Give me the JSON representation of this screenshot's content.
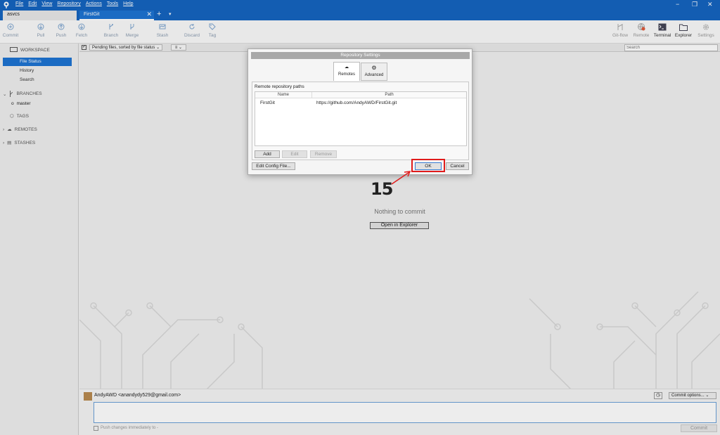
{
  "menu": [
    "File",
    "Edit",
    "View",
    "Repository",
    "Actions",
    "Tools",
    "Help"
  ],
  "tabs": {
    "tab1": "asvcs",
    "tab2": "FirstGit",
    "add": "+",
    "dropdown": "▾",
    "close": "✕"
  },
  "window": {
    "minimize": "−",
    "restore": "❐",
    "close": "✕"
  },
  "toolbar": {
    "commit": "Commit",
    "pull": "Pull",
    "push": "Push",
    "fetch": "Fetch",
    "branch": "Branch",
    "merge": "Merge",
    "stash": "Stash",
    "discard": "Discard",
    "tag": "Tag",
    "gitflow": "Git-flow",
    "remote": "Remote",
    "terminal": "Terminal",
    "explorer": "Explorer",
    "settings": "Settings",
    "remote_badge": "1"
  },
  "sidebar": {
    "workspace": "WORKSPACE",
    "file_status": "File Status",
    "history": "History",
    "search": "Search",
    "branches": "BRANCHES",
    "master": "master",
    "tags": "TAGS",
    "remotes": "REMOTES",
    "stashes": "STASHES"
  },
  "filter": {
    "label": "Pending files, sorted by file status",
    "search_placeholder": "Search"
  },
  "main": {
    "nothing": "Nothing to commit",
    "open_explorer": "Open in Explorer"
  },
  "bottom": {
    "author": "AndyAWD <anandydy529@gmail.com>",
    "commit_options": "Commit options...",
    "push_label": "Push changes immediately to -",
    "commit_btn": "Commit"
  },
  "dialog": {
    "title": "Repository Settings",
    "tab_remotes": "Remotes",
    "tab_advanced": "Advanced",
    "section": "Remote repository paths",
    "col_name": "Name",
    "col_path": "Path",
    "row_name": "FirstGit",
    "row_path": "https://github.com/AndyAWD/FirstGit.git",
    "add": "Add",
    "edit": "Edit",
    "remove": "Remove",
    "edit_config": "Edit Config File...",
    "ok": "OK",
    "cancel": "Cancel"
  },
  "annotation": "15"
}
